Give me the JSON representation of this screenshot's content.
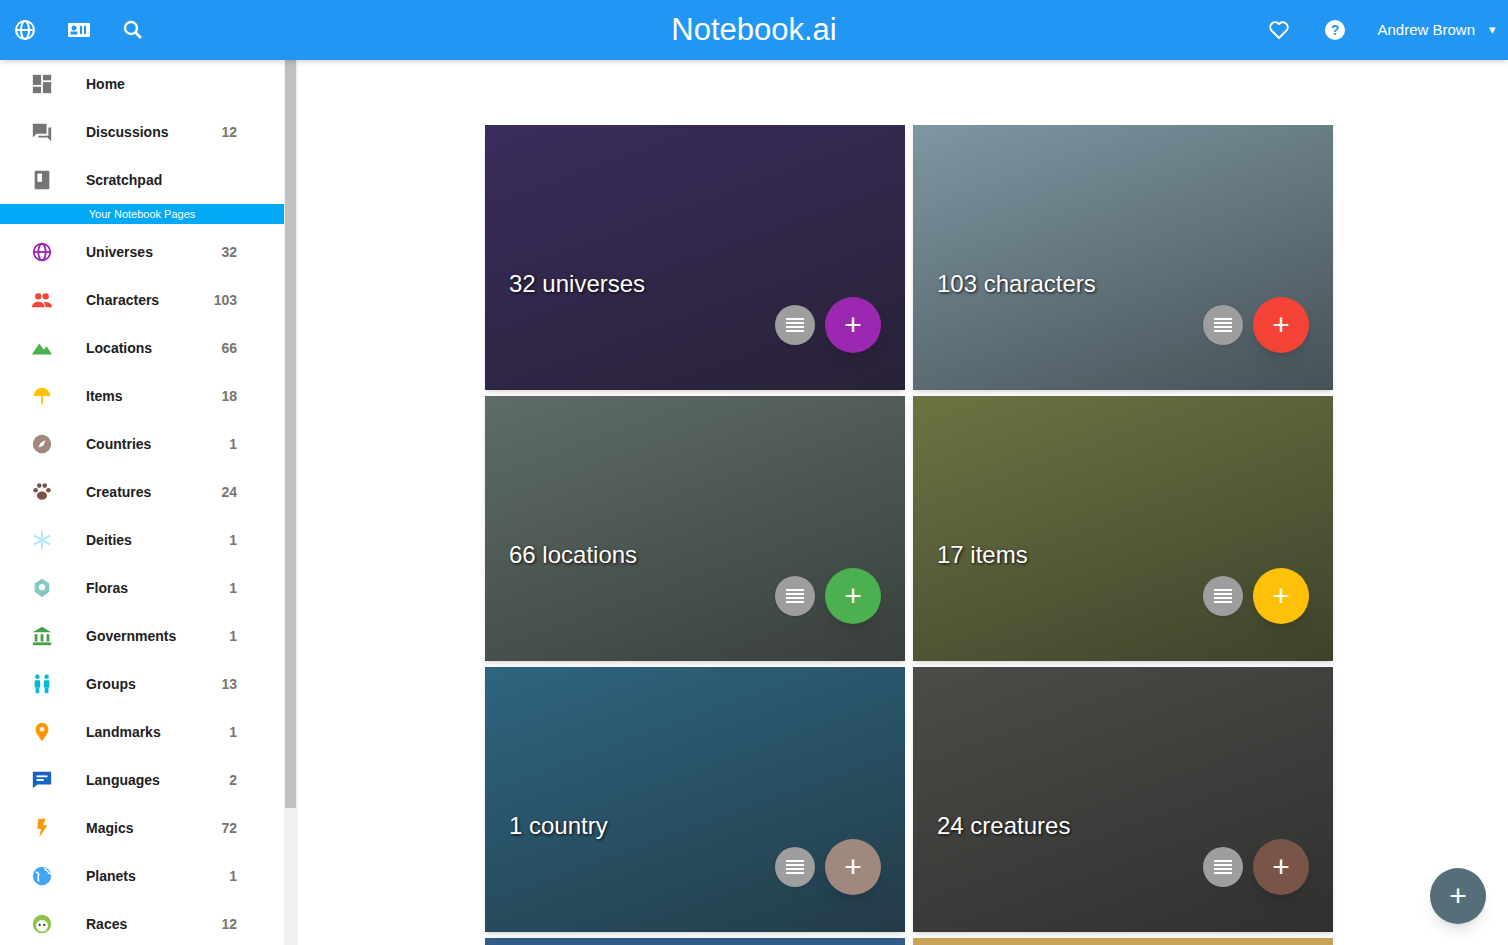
{
  "topbar": {
    "title": "Notebook.ai",
    "user": "Andrew Brown",
    "user_arrow": "▾"
  },
  "sidebar": {
    "items": [
      {
        "label": "Home",
        "count": "",
        "color": "#757575"
      },
      {
        "label": "Discussions",
        "count": "12",
        "color": "#757575"
      },
      {
        "label": "Scratchpad",
        "count": "",
        "color": "#757575"
      }
    ],
    "section": "Your Notebook Pages",
    "pages": [
      {
        "label": "Universes",
        "count": "32",
        "color": "#9c27b0"
      },
      {
        "label": "Characters",
        "count": "103",
        "color": "#f44336"
      },
      {
        "label": "Locations",
        "count": "66",
        "color": "#4caf50"
      },
      {
        "label": "Items",
        "count": "18",
        "color": "#ffc107"
      },
      {
        "label": "Countries",
        "count": "1",
        "color": "#a1887f"
      },
      {
        "label": "Creatures",
        "count": "24",
        "color": "#795548"
      },
      {
        "label": "Deities",
        "count": "1",
        "color": "#b3e5fc"
      },
      {
        "label": "Floras",
        "count": "1",
        "color": "#80cbc4"
      },
      {
        "label": "Governments",
        "count": "1",
        "color": "#43a047"
      },
      {
        "label": "Groups",
        "count": "13",
        "color": "#00bcd4"
      },
      {
        "label": "Landmarks",
        "count": "1",
        "color": "#ff9800"
      },
      {
        "label": "Languages",
        "count": "2",
        "color": "#1565c0"
      },
      {
        "label": "Magics",
        "count": "72",
        "color": "#ff9800"
      },
      {
        "label": "Planets",
        "count": "1",
        "color": "#42a5f5"
      },
      {
        "label": "Races",
        "count": "12",
        "color": "#8bc34a"
      }
    ]
  },
  "cards": [
    {
      "label": "32 universes",
      "add": "+",
      "color": "#9c27b0",
      "photo_color": "#3a2c5c"
    },
    {
      "label": "103 characters",
      "add": "+",
      "color": "#f44336",
      "photo_color": "#7e97a2"
    },
    {
      "label": "66 locations",
      "add": "+",
      "color": "#4caf50",
      "photo_color": "#5f6d66"
    },
    {
      "label": "17 items",
      "add": "+",
      "color": "#ffc107",
      "photo_color": "#6c7442"
    },
    {
      "label": "1 country",
      "add": "+",
      "color": "#a1887f",
      "photo_color": "#2e6580"
    },
    {
      "label": "24 creatures",
      "add": "+",
      "color": "#795548",
      "photo_color": "#4b4b48"
    }
  ],
  "cards_below": [
    {
      "photo_color": "#2f5d86"
    },
    {
      "photo_color": "#c9a35a"
    }
  ],
  "fab": {
    "label": "+"
  }
}
